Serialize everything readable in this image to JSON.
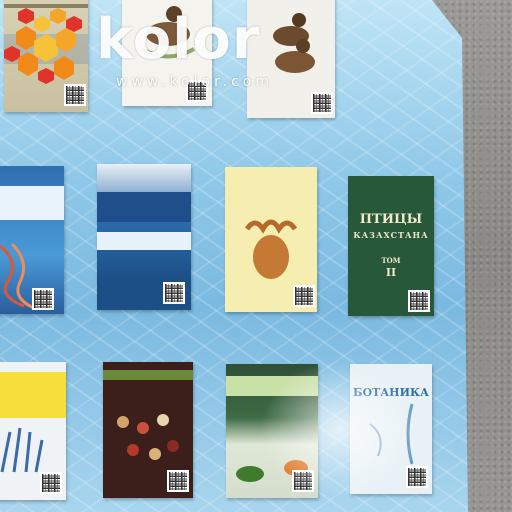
{
  "watermark": {
    "word": "kolor",
    "url": "www.kolor.com"
  },
  "colors": {
    "board_blue": "#8fc8e8",
    "carpet_gray": "#8f8f8d",
    "logo_orange": "#f28a1a",
    "logo_red": "#e0342b"
  },
  "books": [
    {
      "id": "b1",
      "cover": "beige cover"
    },
    {
      "id": "b2",
      "cover": "white cover, ducks"
    },
    {
      "id": "b3",
      "cover": "white cover, ducks"
    },
    {
      "id": "b4",
      "cover": "blue cover, DNA"
    },
    {
      "id": "b5",
      "cover": "blue and white cover"
    },
    {
      "id": "b6",
      "cover": "yellow cover, moose"
    },
    {
      "id": "b7",
      "cover": "dark green cover",
      "title": "ПТИЦЫ",
      "subtitle": "КАЗАХСТАНА",
      "volume": "ТОМ",
      "volume_number": "II"
    },
    {
      "id": "b8",
      "cover": "white and yellow cover, hand"
    },
    {
      "id": "b9",
      "cover": "dark red cover, beads"
    },
    {
      "id": "b10",
      "cover": "green cover, leaves"
    },
    {
      "id": "b11",
      "cover": "light blue cover",
      "title": "БОТАНИКА"
    }
  ]
}
